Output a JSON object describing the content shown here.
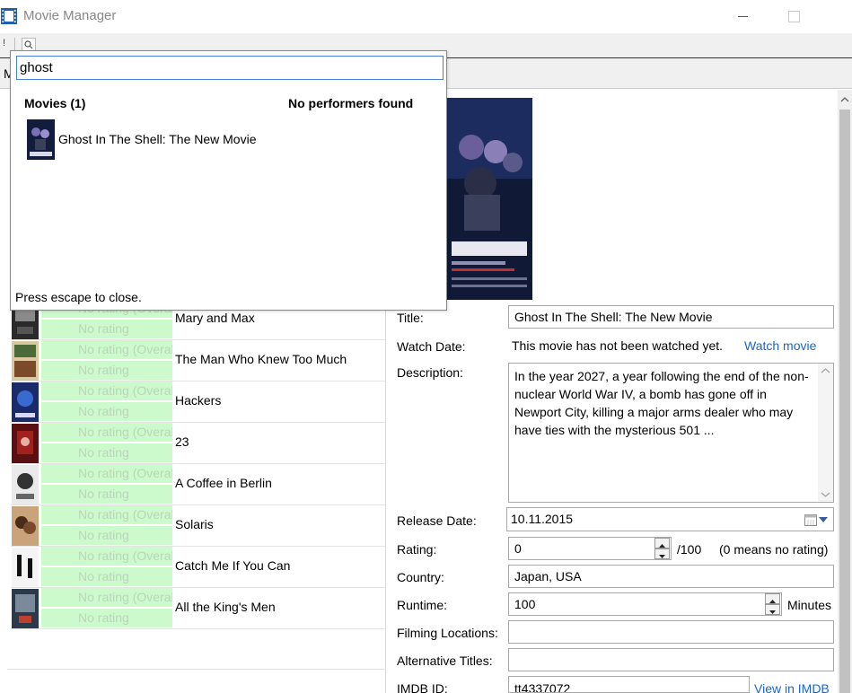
{
  "window": {
    "title": "Movie Manager"
  },
  "toolbar": {
    "excl": "!",
    "tab_initial": "M"
  },
  "search_popup": {
    "query": "ghost",
    "movies_header": "Movies (1)",
    "performers_header": "No performers found",
    "results": [
      {
        "title": "Ghost In The Shell: The New Movie"
      }
    ],
    "hint": "Press escape to close."
  },
  "movie_list": [
    {
      "title": "Mary and Max",
      "overall": "No rating (Overall)",
      "rating": "No rating"
    },
    {
      "title": "The Man Who Knew Too Much",
      "overall": "No rating (Overall)",
      "rating": "No rating"
    },
    {
      "title": "Hackers",
      "overall": "No rating (Overall)",
      "rating": "No rating"
    },
    {
      "title": "23",
      "overall": "No rating (Overall)",
      "rating": "No rating"
    },
    {
      "title": "A Coffee in Berlin",
      "overall": "No rating (Overall)",
      "rating": "No rating"
    },
    {
      "title": "Solaris",
      "overall": "No rating (Overall)",
      "rating": "No rating"
    },
    {
      "title": "Catch Me If You Can",
      "overall": "No rating (Overall)",
      "rating": "No rating"
    },
    {
      "title": "All the King's Men",
      "overall": "No rating (Overall)",
      "rating": "No rating"
    }
  ],
  "details": {
    "labels": {
      "title": "Title:",
      "watch_date": "Watch Date:",
      "description": "Description:",
      "release_date": "Release Date:",
      "rating": "Rating:",
      "country": "Country:",
      "runtime": "Runtime:",
      "filming_locations": "Filming Locations:",
      "alternative_titles": "Alternative Titles:",
      "imdb_id": "IMDB ID:"
    },
    "title": "Ghost In The Shell: The New Movie",
    "watch_status": "This movie has not been watched yet.",
    "watch_link": "Watch movie",
    "description": "In the year 2027, a year following the end of the non-nuclear World War IV, a bomb has gone off in Newport City, killing a major arms dealer who may have ties with the mysterious 501 ...",
    "release_date": "10.11.2015",
    "rating": "0",
    "rating_suffix": "/100",
    "rating_note": "(0 means no rating)",
    "country": "Japan, USA",
    "runtime": "100",
    "runtime_unit": "Minutes",
    "filming_locations": "",
    "alternative_titles": "",
    "imdb_id": "tt4337072",
    "imdb_link": "View in IMDB"
  },
  "colors": {
    "rating_bg": "#cdfacd",
    "rating_text": "#b9d6b9",
    "link": "#1a66cc"
  }
}
